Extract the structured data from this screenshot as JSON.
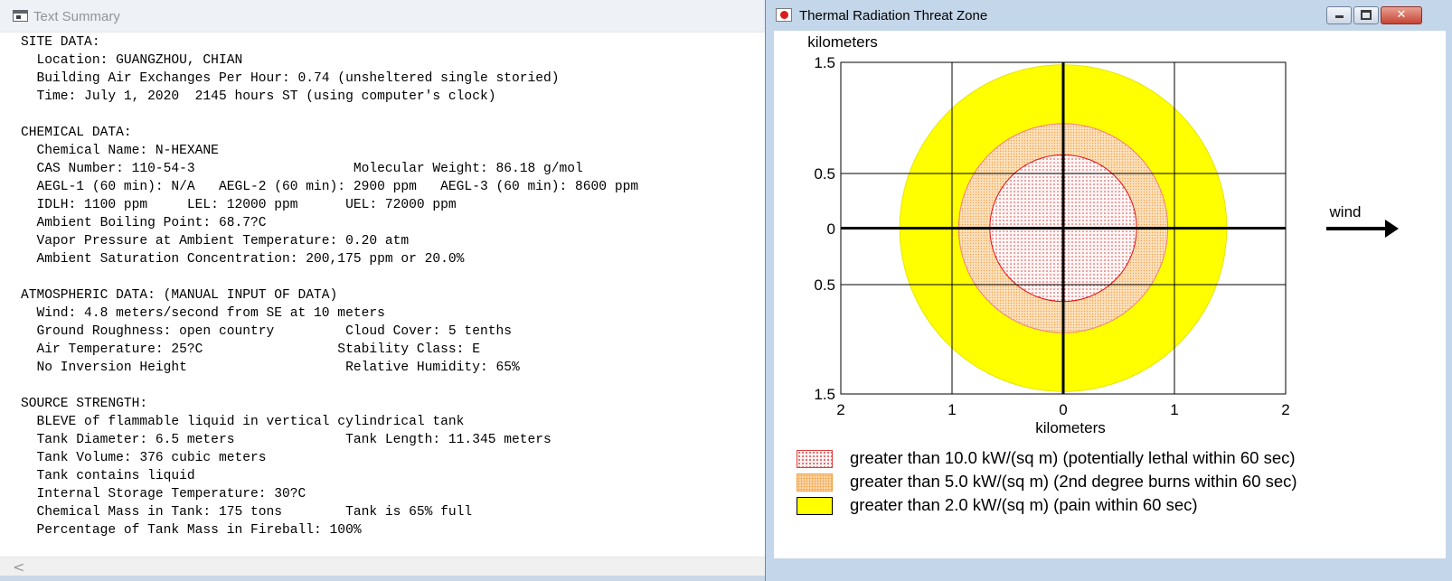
{
  "left_window": {
    "title": "Text Summary",
    "summary_lines": [
      "SITE DATA:",
      "  Location: GUANGZHOU, CHIAN",
      "  Building Air Exchanges Per Hour: 0.74 (unsheltered single storied)",
      "  Time: July 1, 2020  2145 hours ST (using computer's clock)",
      "",
      "CHEMICAL DATA:",
      "  Chemical Name: N-HEXANE",
      "  CAS Number: 110-54-3                    Molecular Weight: 86.18 g/mol",
      "  AEGL-1 (60 min): N/A   AEGL-2 (60 min): 2900 ppm   AEGL-3 (60 min): 8600 ppm",
      "  IDLH: 1100 ppm     LEL: 12000 ppm      UEL: 72000 ppm",
      "  Ambient Boiling Point: 68.7?C",
      "  Vapor Pressure at Ambient Temperature: 0.20 atm",
      "  Ambient Saturation Concentration: 200,175 ppm or 20.0%",
      "",
      "ATMOSPHERIC DATA: (MANUAL INPUT OF DATA)",
      "  Wind: 4.8 meters/second from SE at 10 meters",
      "  Ground Roughness: open country         Cloud Cover: 5 tenths",
      "  Air Temperature: 25?C                 Stability Class: E",
      "  No Inversion Height                    Relative Humidity: 65%",
      "",
      "SOURCE STRENGTH:",
      "  BLEVE of flammable liquid in vertical cylindrical tank",
      "  Tank Diameter: 6.5 meters              Tank Length: 11.345 meters",
      "  Tank Volume: 376 cubic meters",
      "  Tank contains liquid",
      "  Internal Storage Temperature: 30?C",
      "  Chemical Mass in Tank: 175 tons        Tank is 65% full",
      "  Percentage of Tank Mass in Fireball: 100%"
    ],
    "scroll_left_arrow": "<"
  },
  "right_window": {
    "title": "Thermal Radiation Threat Zone",
    "buttons": {
      "minimize": "",
      "maximize": "",
      "close": "✕"
    },
    "wind_label": "wind",
    "legend": [
      {
        "label": "greater than 10.0 kW/(sq m) (potentially lethal within 60 sec)",
        "pattern": "dotted-red"
      },
      {
        "label": "greater than 5.0 kW/(sq m) (2nd degree burns within 60 sec)",
        "pattern": "dotted-orange"
      },
      {
        "label": "greater than 2.0 kW/(sq m) (pain within 60 sec)",
        "pattern": "solid-yellow"
      }
    ]
  },
  "chart_data": {
    "type": "area",
    "xlabel": "kilometers",
    "ylabel": "kilometers",
    "x_ticks": [
      "2",
      "1",
      "0",
      "1",
      "2"
    ],
    "y_ticks": [
      "1.5",
      "0.5",
      "0",
      "0.5",
      "1.5"
    ],
    "xlim": [
      -2,
      2
    ],
    "ylim": [
      -1.5,
      1.5
    ],
    "grid_x": [
      -2,
      -1,
      0,
      1,
      2
    ],
    "grid_y": [
      -1.5,
      -0.5,
      0,
      0.5,
      1.5
    ],
    "zones": [
      {
        "name": "greater than 2.0 kW/(sq m) (pain within 60 sec)",
        "radius_km": 1.47,
        "fill": "#ffff00",
        "stroke": "#e6e600"
      },
      {
        "name": "greater than 5.0 kW/(sq m) (2nd degree burns within 60 sec)",
        "radius_km": 0.94,
        "fill": "#fbd8aa",
        "stroke": "#f08080"
      },
      {
        "name": "greater than 10.0 kW/(sq m) (potentially lethal within 60 sec)",
        "radius_km": 0.66,
        "fill": "#fff3f3",
        "stroke": "#e01010"
      }
    ],
    "wind_direction": "right"
  }
}
